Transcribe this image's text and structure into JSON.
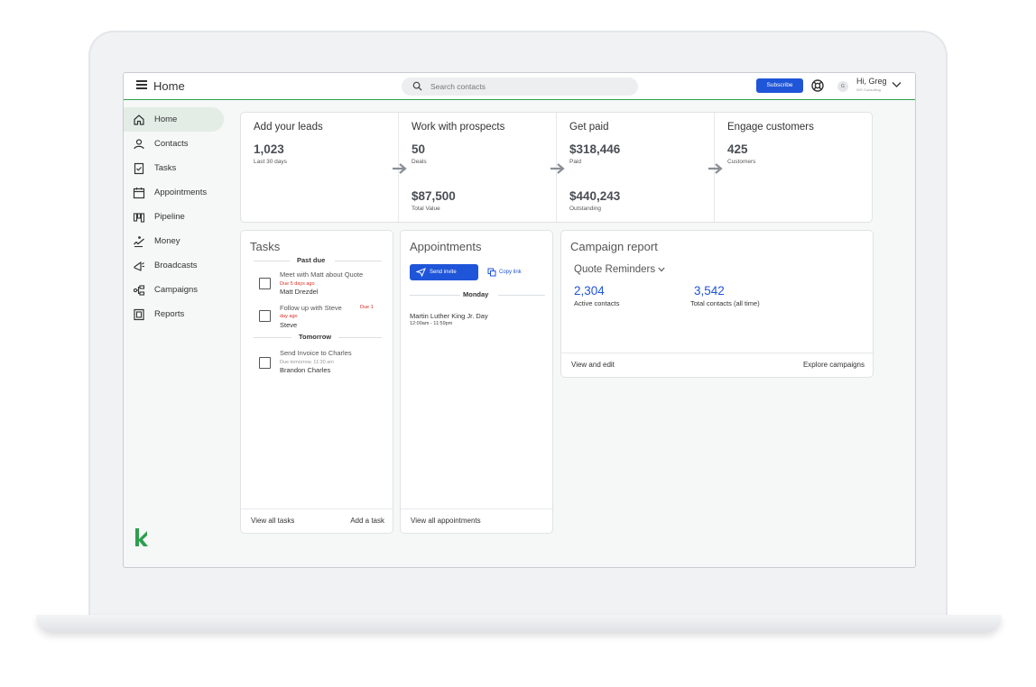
{
  "header": {
    "title": "Home",
    "search_placeholder": "Search contacts",
    "subscribe_label": "Subscribe",
    "avatar_initial": "G",
    "greeting": "Hi, Greg",
    "company": "WG Consulting"
  },
  "sidebar": {
    "items": [
      {
        "label": "Home",
        "icon": "home-icon"
      },
      {
        "label": "Contacts",
        "icon": "person-icon"
      },
      {
        "label": "Tasks",
        "icon": "checklist-icon"
      },
      {
        "label": "Appointments",
        "icon": "calendar-icon"
      },
      {
        "label": "Pipeline",
        "icon": "pipeline-icon"
      },
      {
        "label": "Money",
        "icon": "money-icon"
      },
      {
        "label": "Broadcasts",
        "icon": "megaphone-icon"
      },
      {
        "label": "Campaigns",
        "icon": "campaign-icon"
      },
      {
        "label": "Reports",
        "icon": "report-icon"
      }
    ],
    "brand_icon": "keap-logo-icon"
  },
  "summary": {
    "leads": {
      "title": "Add your leads",
      "value": "1,023",
      "caption": "Last 30 days"
    },
    "prospects": {
      "title": "Work with prospects",
      "value": "50",
      "caption": "Deals",
      "value2": "$87,500",
      "caption2": "Total Value"
    },
    "paid": {
      "title": "Get paid",
      "value": "$318,446",
      "caption": "Paid",
      "value2": "$440,243",
      "caption2": "Outstanding"
    },
    "customers": {
      "title": "Engage customers",
      "value": "425",
      "caption": "Customers"
    }
  },
  "tasks": {
    "title": "Tasks",
    "past_due_label": "Past due",
    "tomorrow_label": "Tomorrow",
    "items": [
      {
        "title": "Meet with Matt about Quote",
        "due": "Due 5 days ago",
        "person": "Matt Drezdel"
      },
      {
        "title": "Follow up with Steve",
        "due_a": "Due 1",
        "due_b": "day ago",
        "person": "Steve"
      },
      {
        "title": "Send Invoice to Charles",
        "due": "Due tomorrow, 11:30 am",
        "person": "Brandon Charles"
      }
    ],
    "view_all": "View all tasks",
    "add": "Add a task"
  },
  "appointments": {
    "title": "Appointments",
    "send_invite": "Send invite",
    "copy_link": "Copy link",
    "day_label": "Monday",
    "event_name": "Martin Luther King Jr. Day",
    "event_time": "12:00am - 11:59pm",
    "view_all": "View all appointments"
  },
  "campaign": {
    "title": "Campaign report",
    "selected": "Quote Reminders",
    "active_value": "2,304",
    "active_label": "Active contacts",
    "total_value": "3,542",
    "total_label": "Total contacts (all time)",
    "view_edit": "View and edit",
    "explore": "Explore campaigns"
  },
  "colors": {
    "accent_green": "#2e9e4f",
    "primary_blue": "#1f55d8",
    "due_red": "#d93025"
  }
}
